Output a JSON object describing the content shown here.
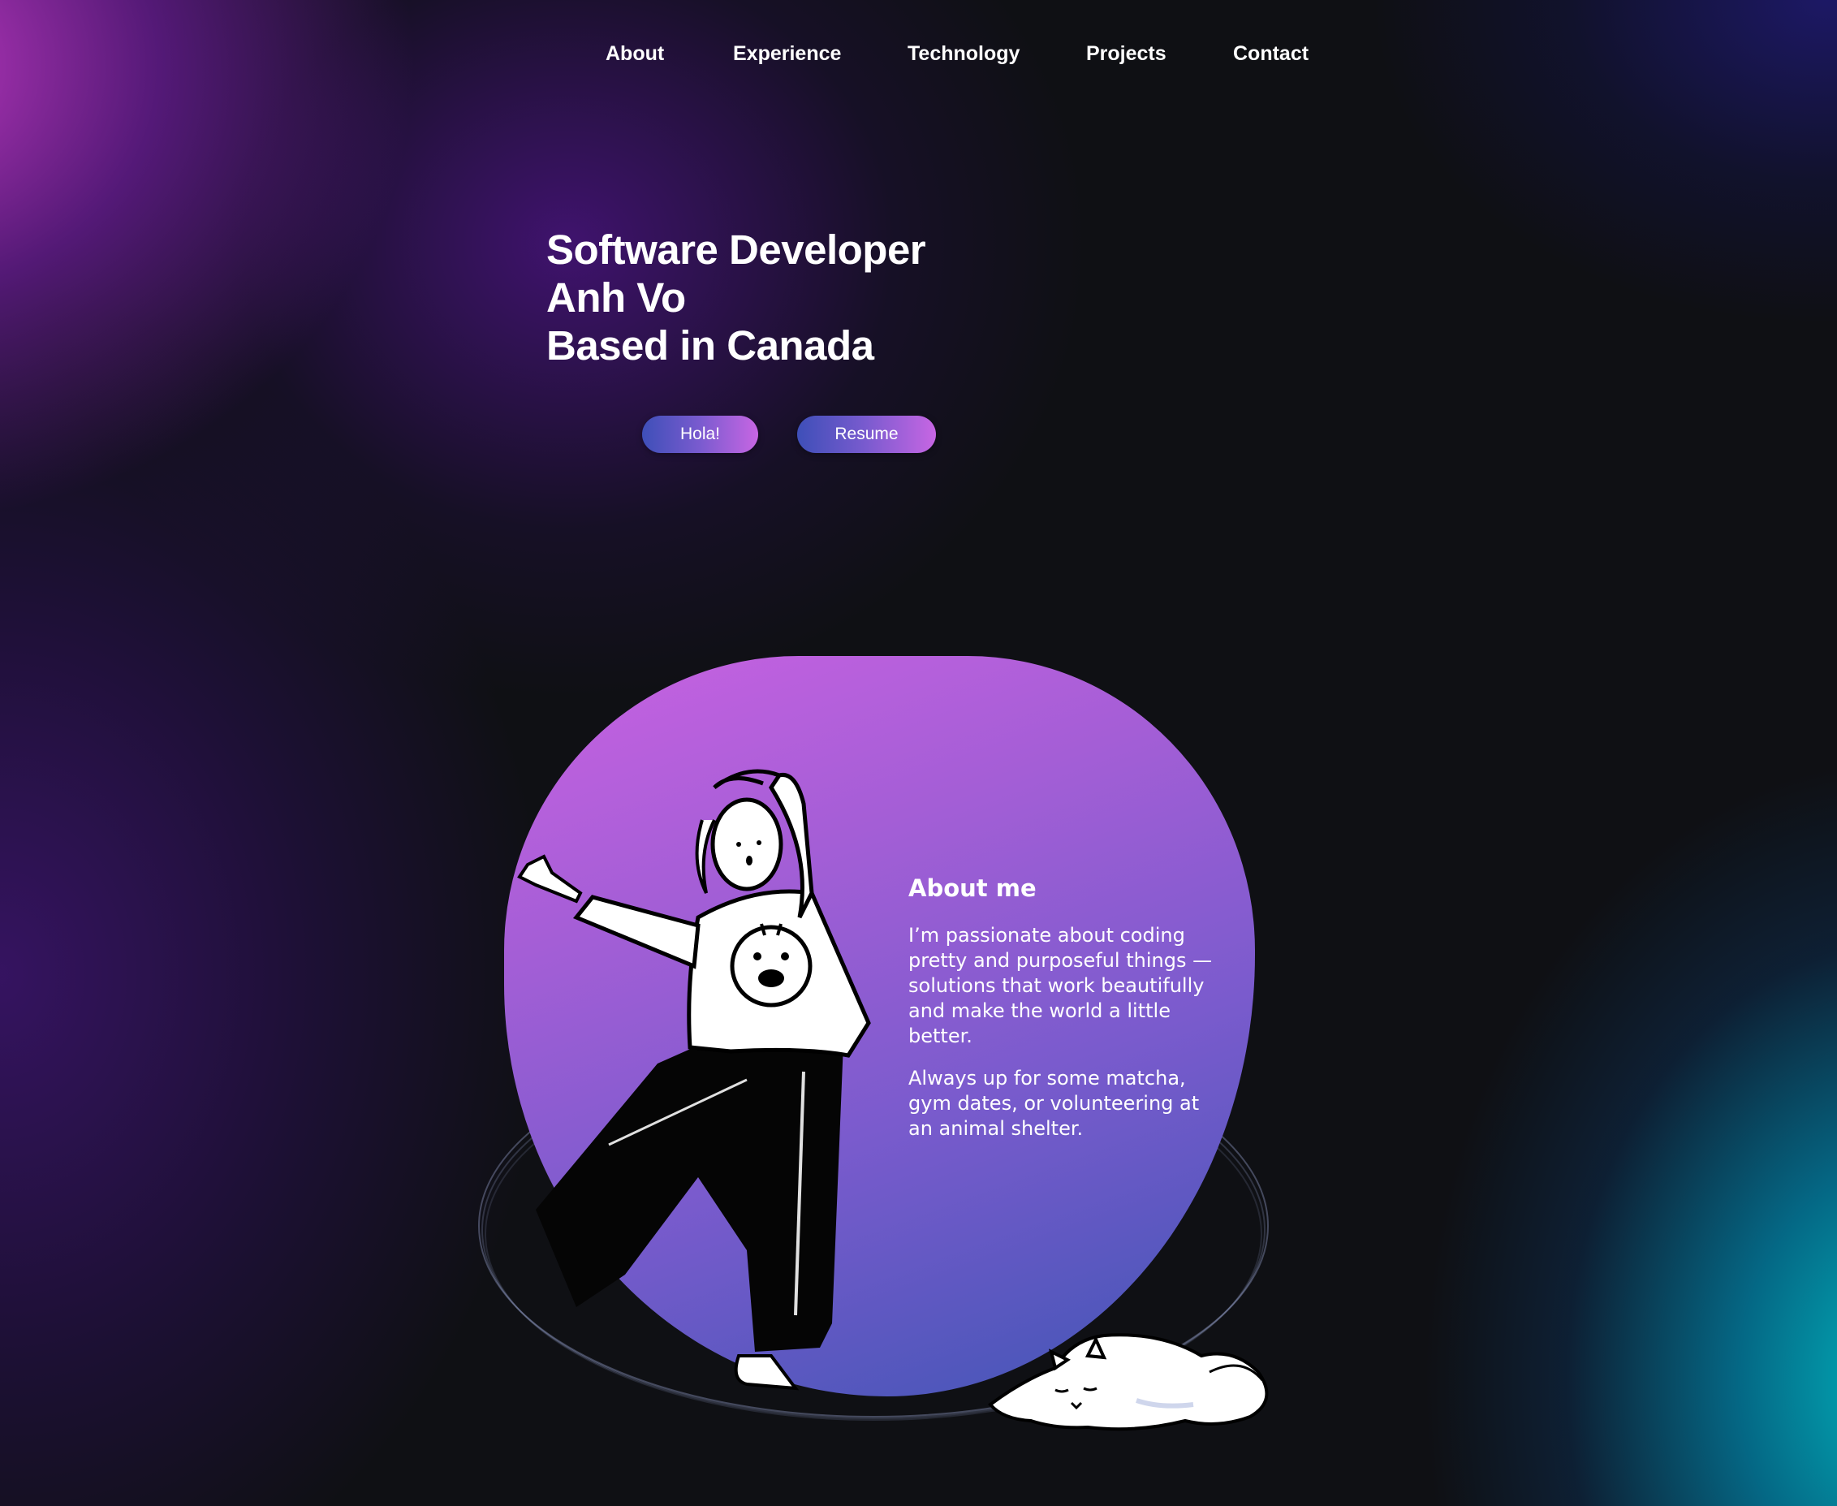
{
  "nav": {
    "items": [
      {
        "label": "About"
      },
      {
        "label": "Experience"
      },
      {
        "label": "Technology"
      },
      {
        "label": "Projects"
      },
      {
        "label": "Contact"
      }
    ]
  },
  "hero": {
    "lines": [
      "Software Developer",
      "Anh Vo",
      "Based in Canada"
    ],
    "buttons": {
      "hola": "Hola!",
      "resume": "Resume"
    }
  },
  "about": {
    "title": "About me",
    "paragraph1": "I’m passionate about coding pretty and purposeful things — solutions that work beautifully and make the world a little better.",
    "paragraph2": "Always up for some matcha, gym dates, or volunteering at an animal shelter."
  },
  "colors": {
    "accent_pink": "#c962e2",
    "accent_blue": "#3e55b4",
    "background": "#0f1014"
  },
  "illustrations": [
    "dancing-person-illustration",
    "sleeping-cat-illustration"
  ]
}
